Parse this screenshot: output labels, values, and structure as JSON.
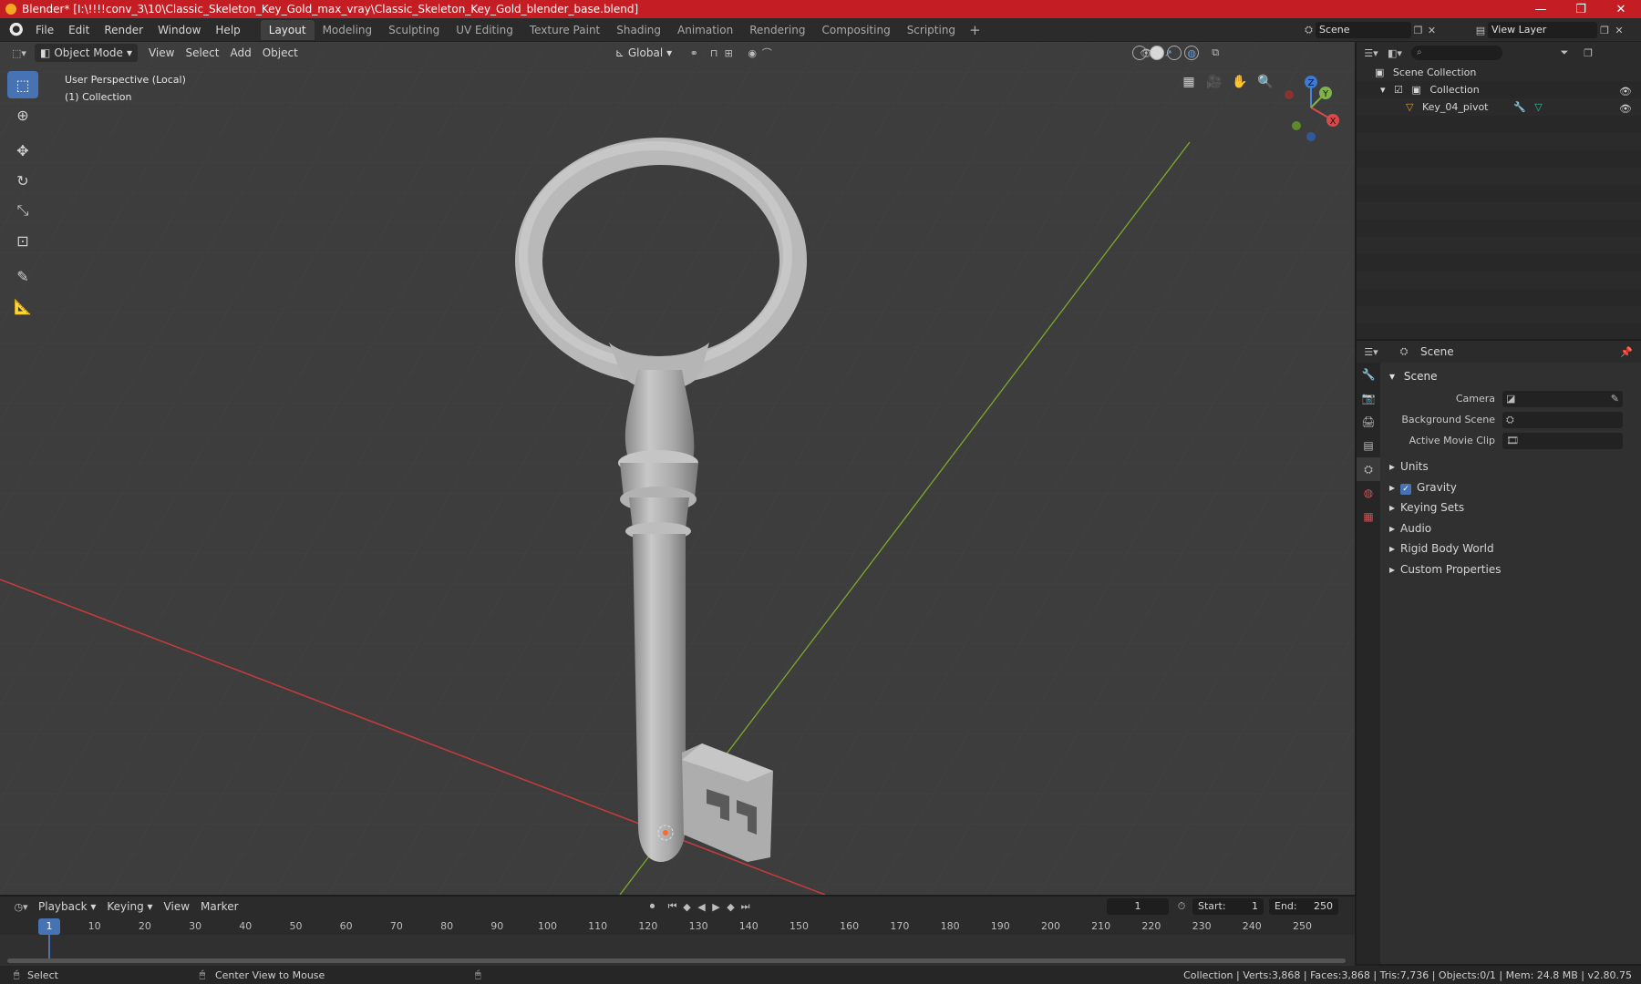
{
  "window": {
    "title": "Blender* [I:\\!!!!conv_3\\10\\Classic_Skeleton_Key_Gold_max_vray\\Classic_Skeleton_Key_Gold_blender_base.blend]",
    "minimize": "—",
    "maximize": "❐",
    "close": "✕"
  },
  "menu": [
    "File",
    "Edit",
    "Render",
    "Window",
    "Help"
  ],
  "workspaces": [
    "Layout",
    "Modeling",
    "Sculpting",
    "UV Editing",
    "Texture Paint",
    "Shading",
    "Animation",
    "Rendering",
    "Compositing",
    "Scripting"
  ],
  "workspace_add": "+",
  "scene_selector": "Scene",
  "view_layer_selector": "View Layer",
  "viewport": {
    "mode": "Object Mode",
    "menus": [
      "View",
      "Select",
      "Add",
      "Object"
    ],
    "transform_orientation": "Global",
    "info_line1": "User Perspective (Local)",
    "info_line2": "(1) Collection",
    "gizmo": {
      "x": "X",
      "y": "Y",
      "z": "Z"
    }
  },
  "outliner": {
    "rows": [
      {
        "label": "Scene Collection"
      },
      {
        "label": "Collection"
      },
      {
        "label": "Key_04_pivot"
      }
    ]
  },
  "properties": {
    "header_title": "Scene",
    "panel_title": "Scene",
    "fields": [
      {
        "label": "Camera"
      },
      {
        "label": "Background Scene"
      },
      {
        "label": "Active Movie Clip"
      }
    ],
    "subpanels": [
      "Units",
      "Gravity",
      "Keying Sets",
      "Audio",
      "Rigid Body World",
      "Custom Properties"
    ]
  },
  "timeline": {
    "menus": [
      "Playback",
      "Keying",
      "View",
      "Marker"
    ],
    "current_frame": "1",
    "start_label": "Start:",
    "start": "1",
    "end_label": "End:",
    "end": "250",
    "ruler_current": "1",
    "ruler_ticks": [
      "10",
      "20",
      "30",
      "40",
      "50",
      "60",
      "70",
      "80",
      "90",
      "100",
      "110",
      "120",
      "130",
      "140",
      "150",
      "160",
      "170",
      "180",
      "190",
      "200",
      "210",
      "220",
      "230",
      "240",
      "250"
    ]
  },
  "statusbar": {
    "left": "Select",
    "middle": "Center View to Mouse",
    "right": "Collection | Verts:3,868 | Faces:3,868 | Tris:7,736 | Objects:0/1 | Mem: 24.8 MB | v2.80.75"
  },
  "colors": {
    "accent": "#4772b3",
    "titlebar": "#c41d23",
    "viewport_bg": "#3d3d3d",
    "axis_x": "#c83b3b",
    "axis_y": "#7fa82c"
  }
}
